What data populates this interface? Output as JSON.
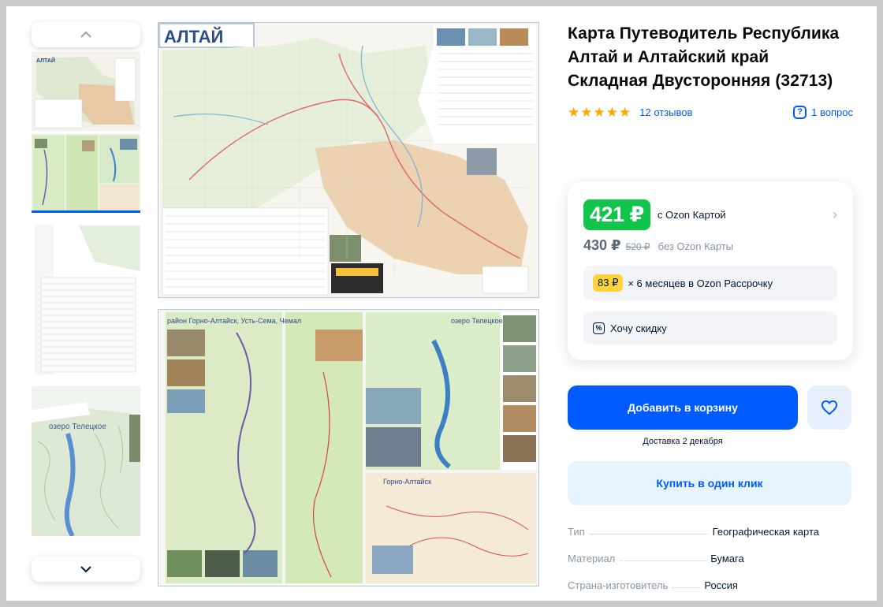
{
  "product": {
    "title": "Карта Путеводитель Республика Алтай и Алтайский край Складная Двусторонняя (32713)",
    "rating_stars": 5,
    "reviews_label": "12 отзывов",
    "questions_label": "1 вопрос"
  },
  "price": {
    "ozon_card_price": "421 ₽",
    "ozon_card_label": "с Ozon Картой",
    "regular_price": "430 ₽",
    "old_price": "520 ₽",
    "no_card_label": "без Ozon Карты",
    "installment_amount": "83 ₽",
    "installment_text": "× 6 месяцев в Ozon Рассрочку",
    "discount_label": "Хочу скидку"
  },
  "actions": {
    "add_to_cart": "Добавить в корзину",
    "delivery_prefix": "Доставка",
    "delivery_date": "2 декабря",
    "buy_one_click": "Купить в один клик"
  },
  "specs": [
    {
      "key": "Тип",
      "value": "Географическая карта"
    },
    {
      "key": "Материал",
      "value": "Бумага"
    },
    {
      "key": "Страна-изготовитель",
      "value": "Россия"
    }
  ],
  "gallery": {
    "map_title": "АЛТАЙ",
    "inset_1": "район Горно-Алтайск, Усть-Сема, Чемал",
    "inset_2": "озеро Телецкое",
    "inset_3": "Горно-Алтайск",
    "thumb_inset": "озеро Телецкое"
  },
  "colors": {
    "accent": "#005bff",
    "ozon_price": "#10c44c",
    "stars": "#ffa800",
    "installment_badge": "#ffd43a"
  },
  "icons": [
    "chevron-up-icon",
    "chevron-down-icon",
    "star-icon",
    "question-icon",
    "chevron-right-icon",
    "percent-icon",
    "heart-icon"
  ]
}
